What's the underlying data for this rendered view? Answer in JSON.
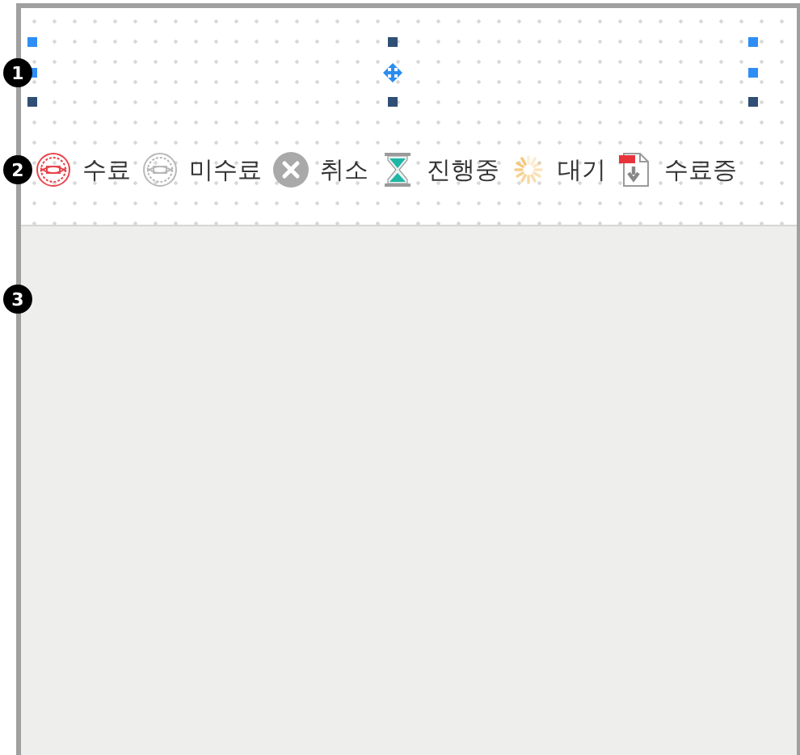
{
  "markers": [
    "1",
    "2",
    "3"
  ],
  "legend": [
    {
      "kind": "stamp-red",
      "label": "수료"
    },
    {
      "kind": "stamp-gray",
      "label": "미수료"
    },
    {
      "kind": "cancel",
      "label": "취소"
    },
    {
      "kind": "hourglass",
      "label": "진행중"
    },
    {
      "kind": "spinner",
      "label": "대기"
    },
    {
      "kind": "pdf",
      "label": "수료증"
    }
  ]
}
